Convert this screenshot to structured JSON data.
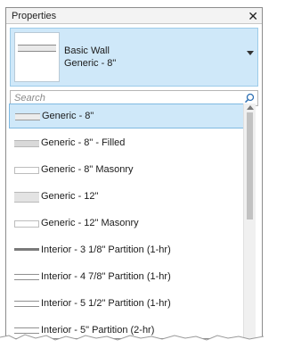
{
  "panel": {
    "title": "Properties",
    "close_glyph": "✕"
  },
  "type_selector": {
    "family": "Basic Wall",
    "type": "Generic - 8\""
  },
  "search": {
    "placeholder": "Search"
  },
  "items": [
    {
      "label": "Generic - 8\"",
      "icon": "plain",
      "selected": true
    },
    {
      "label": "Generic - 8\" - Filled",
      "icon": "filled",
      "selected": false
    },
    {
      "label": "Generic - 8\" Masonry",
      "icon": "masonry",
      "selected": false
    },
    {
      "label": "Generic - 12\"",
      "icon": "thick",
      "selected": false
    },
    {
      "label": "Generic - 12\" Masonry",
      "icon": "masonry",
      "selected": false
    },
    {
      "label": "Interior - 3 1/8\" Partition (1-hr)",
      "icon": "dark",
      "selected": false
    },
    {
      "label": "Interior - 4 7/8\" Partition (1-hr)",
      "icon": "double",
      "selected": false
    },
    {
      "label": "Interior - 5 1/2\" Partition (1-hr)",
      "icon": "double",
      "selected": false
    },
    {
      "label": "Interior - 5\" Partition (2-hr)",
      "icon": "double",
      "selected": false
    }
  ]
}
